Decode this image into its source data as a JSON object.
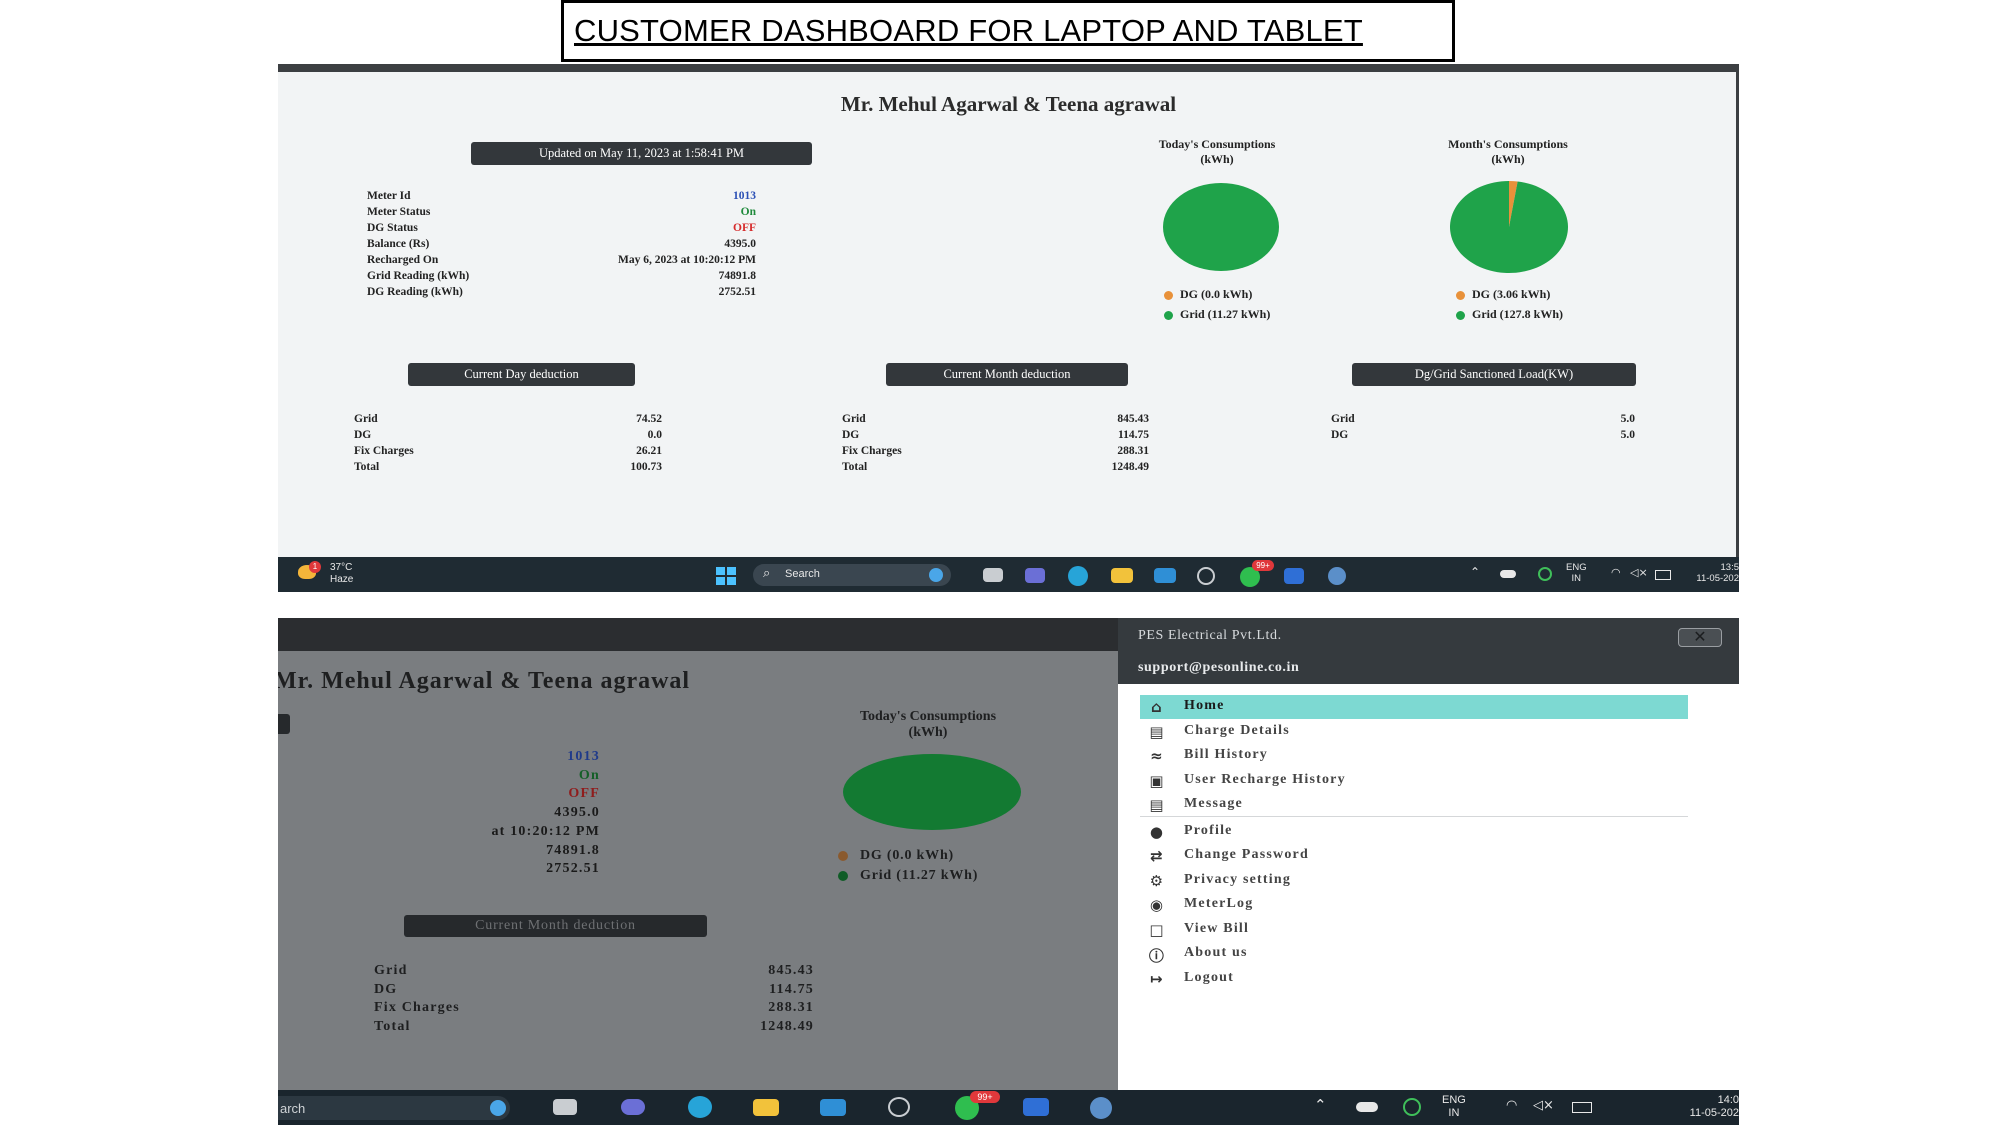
{
  "slide": {
    "title": "CUSTOMER DASHBOARD FOR LAPTOP AND TABLET"
  },
  "dashboard": {
    "customer_name": "Mr. Mehul Agarwal & Teena agrawal",
    "updated_label": "Updated on May 11, 2023 at 1:58:41 PM",
    "info_rows": [
      {
        "label": "Meter Id",
        "value": "1013",
        "color": "#2a4fb5"
      },
      {
        "label": "Meter Status",
        "value": "On",
        "color": "#1f8a3b"
      },
      {
        "label": "DG Status",
        "value": "OFF",
        "color": "#d62b2b"
      },
      {
        "label": "Balance (Rs)",
        "value": "4395.0",
        "color": "#222222"
      },
      {
        "label": "Recharged On",
        "value": "May 6, 2023 at 10:20:12 PM",
        "color": "#222222"
      },
      {
        "label": "Grid Reading (kWh)",
        "value": "74891.8",
        "color": "#222222"
      },
      {
        "label": "DG Reading (kWh)",
        "value": "2752.51",
        "color": "#222222"
      }
    ],
    "today_chart": {
      "title_line1": "Today's Consumptions",
      "title_line2": "(kWh)",
      "legend": [
        "DG (0.0 kWh)",
        "Grid (11.27 kWh)"
      ]
    },
    "month_chart": {
      "title_line1": "Month's Consumptions",
      "title_line2": "(kWh)",
      "legend": [
        "DG (3.06 kWh)",
        "Grid (127.8 kWh)"
      ]
    },
    "day_deduction": {
      "title": "Current Day deduction",
      "rows": [
        {
          "label": "Grid",
          "value": "74.52"
        },
        {
          "label": "DG",
          "value": "0.0"
        },
        {
          "label": "Fix Charges",
          "value": "26.21"
        },
        {
          "label": "Total",
          "value": "100.73"
        }
      ]
    },
    "month_deduction": {
      "title": "Current Month deduction",
      "rows": [
        {
          "label": "Grid",
          "value": "845.43"
        },
        {
          "label": "DG",
          "value": "114.75"
        },
        {
          "label": "Fix Charges",
          "value": "288.31"
        },
        {
          "label": "Total",
          "value": "1248.49"
        }
      ]
    },
    "sanctioned_load": {
      "title": "Dg/Grid Sanctioned Load(KW)",
      "rows": [
        {
          "label": "Grid",
          "value": "5.0"
        },
        {
          "label": "DG",
          "value": "5.0"
        }
      ]
    }
  },
  "colors": {
    "dg": "#e8913a",
    "grid": "#1fa34a",
    "grid_dim": "#137a32",
    "highlight": "#7dd9d2"
  },
  "chart_data": [
    {
      "type": "pie",
      "title": "Today's Consumptions (kWh)",
      "categories": [
        "DG",
        "Grid"
      ],
      "values": [
        0.0,
        11.27
      ]
    },
    {
      "type": "pie",
      "title": "Month's Consumptions (kWh)",
      "categories": [
        "DG",
        "Grid"
      ],
      "values": [
        3.06,
        127.8
      ]
    }
  ],
  "taskbar1": {
    "weather_temp": "37°C",
    "weather_desc": "Haze",
    "weather_badge": "1",
    "search": "Search",
    "whatsapp_badge": "99+",
    "lang1": "ENG",
    "lang2": "IN",
    "time": "13:5",
    "date": "11-05-202"
  },
  "tablet": {
    "customer_name": "Mr. Mehul Agarwal & Teena agrawal",
    "info_values": [
      {
        "value": "1013",
        "color": "#1f3a8a"
      },
      {
        "value": "On",
        "color": "#155f28"
      },
      {
        "value": "OFF",
        "color": "#8f1c1c"
      },
      {
        "value": "4395.0",
        "color": "#1a1a1a"
      },
      {
        "value": "at 10:20:12 PM",
        "color": "#1a1a1a"
      },
      {
        "value": "74891.8",
        "color": "#1a1a1a"
      },
      {
        "value": "2752.51",
        "color": "#1a1a1a"
      }
    ],
    "today_chart": {
      "title_line1": "Today's Consumptions",
      "title_line2": "(kWh)",
      "legend": [
        "DG (0.0 kWh)",
        "Grid (11.27 kWh)"
      ]
    },
    "month_deduction": {
      "title": "Current Month deduction",
      "rows": [
        {
          "label": "Grid",
          "value": "845.43"
        },
        {
          "label": "DG",
          "value": "114.75"
        },
        {
          "label": "Fix Charges",
          "value": "288.31"
        },
        {
          "label": "Total",
          "value": "1248.49"
        }
      ]
    },
    "drawer": {
      "company": "PES Electrical Pvt.Ltd.",
      "email": "support@pesonline.co.in",
      "menu": [
        {
          "label": "Home",
          "icon": "home-icon"
        },
        {
          "label": "Charge Details",
          "icon": "card-icon"
        },
        {
          "label": "Bill History",
          "icon": "wave-icon"
        },
        {
          "label": "User Recharge History",
          "icon": "wallet-icon"
        },
        {
          "label": "Message",
          "icon": "message-icon"
        },
        {
          "label": "Profile",
          "icon": "user-icon"
        },
        {
          "label": "Change Password",
          "icon": "swap-icon"
        },
        {
          "label": "Privacy setting",
          "icon": "gear-icon"
        },
        {
          "label": "MeterLog",
          "icon": "question-icon"
        },
        {
          "label": "View Bill",
          "icon": "folder-icon"
        },
        {
          "label": "About us",
          "icon": "info-icon"
        },
        {
          "label": "Logout",
          "icon": "logout-icon"
        }
      ]
    }
  },
  "taskbar2": {
    "search_partial": "arch",
    "whatsapp_badge": "99+",
    "lang1": "ENG",
    "lang2": "IN",
    "time": "14:0",
    "date": "11-05-202"
  }
}
